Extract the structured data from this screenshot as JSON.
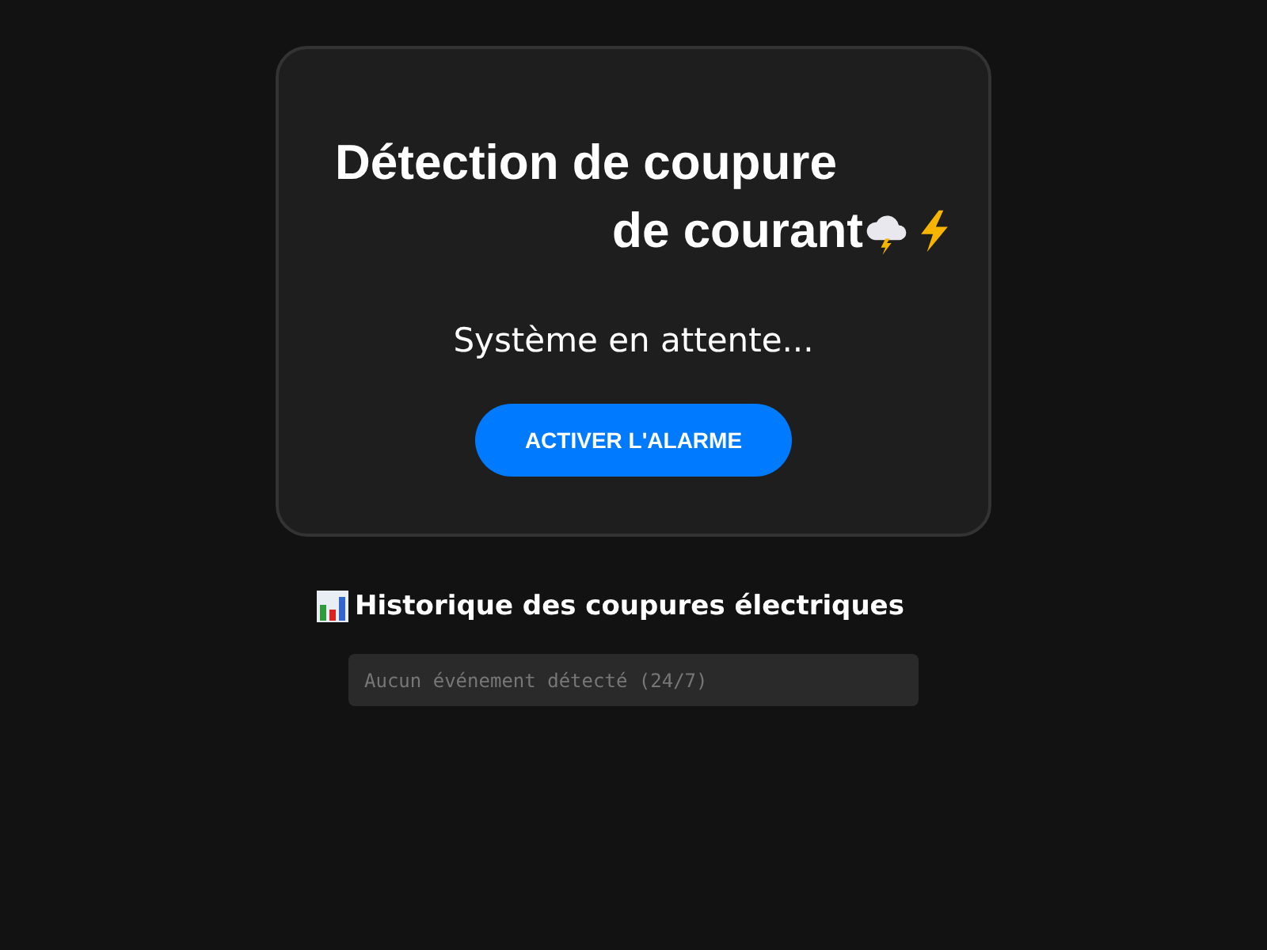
{
  "card": {
    "title": "Détection de coupure de courant",
    "status": "Système en attente...",
    "button": "ACTIVER L'ALARME"
  },
  "history": {
    "title": "Historique des coupures électriques",
    "empty_message": "Aucun événement détecté (24/7)"
  }
}
